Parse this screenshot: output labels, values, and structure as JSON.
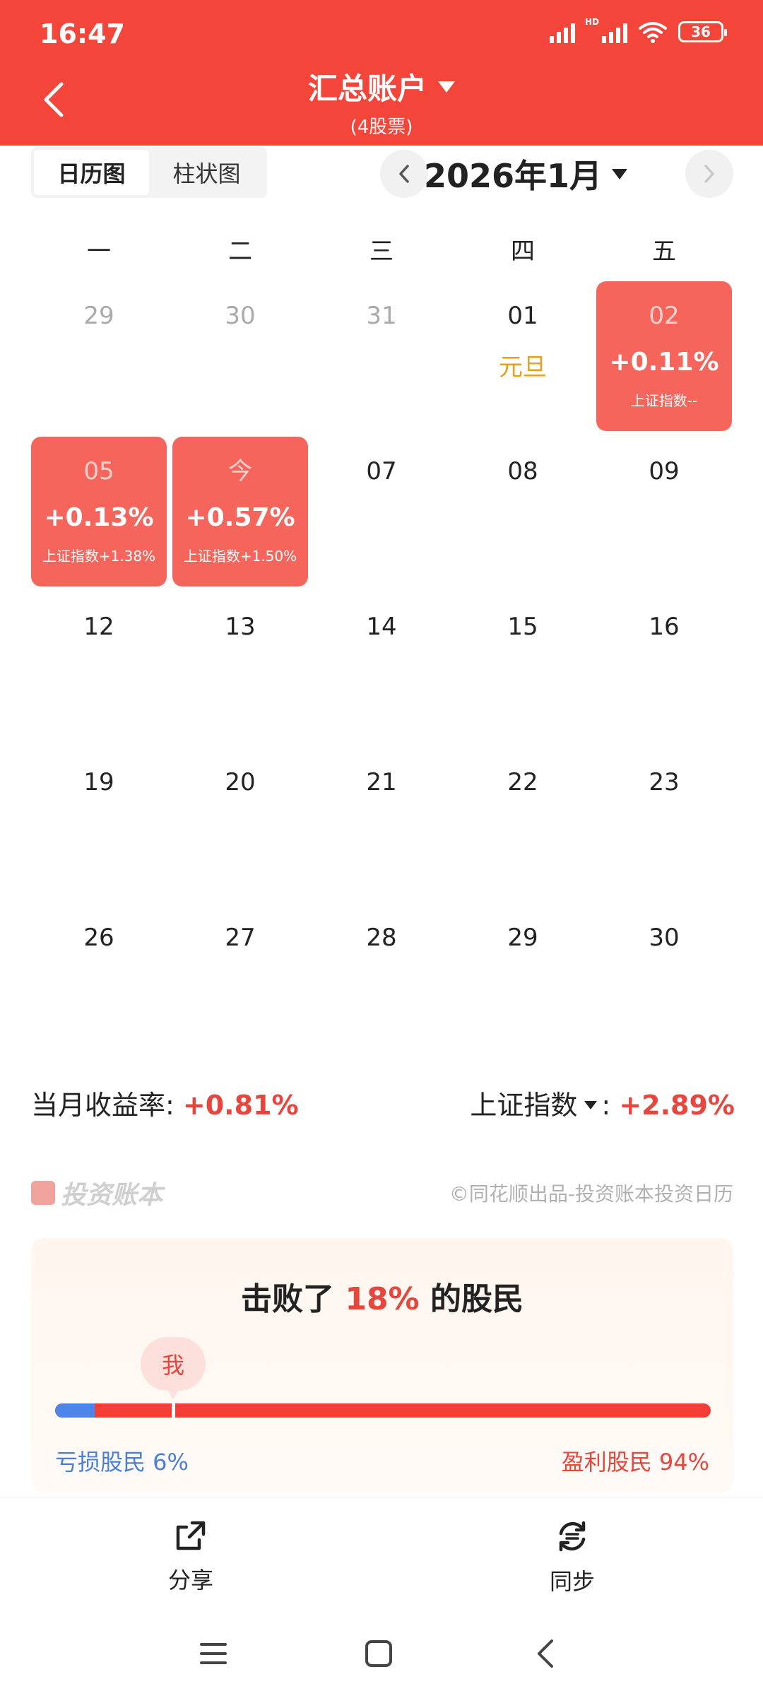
{
  "status_bar": {
    "time": "16:47",
    "hd": "HD",
    "battery": "36"
  },
  "header": {
    "title": "汇总账户",
    "subtitle": "(4股票)"
  },
  "view_toggle": {
    "options": [
      "日历图",
      "柱状图"
    ],
    "active": 0
  },
  "month_nav": {
    "label": "2026年1月"
  },
  "weekdays": [
    "一",
    "二",
    "三",
    "四",
    "五"
  ],
  "calendar": {
    "week1": [
      {
        "day": "29",
        "dim": true
      },
      {
        "day": "30",
        "dim": true
      },
      {
        "day": "31",
        "dim": true
      },
      {
        "day": "01",
        "holiday": "元旦"
      },
      {
        "day": "02",
        "profit": "+0.11%",
        "index": "上证指数--"
      }
    ],
    "week2": [
      {
        "day": "05",
        "profit": "+0.13%",
        "index": "上证指数+1.38%"
      },
      {
        "day": "今",
        "profit": "+0.57%",
        "index": "上证指数+1.50%"
      },
      {
        "day": "07"
      },
      {
        "day": "08"
      },
      {
        "day": "09"
      }
    ],
    "week3": [
      {
        "day": "12"
      },
      {
        "day": "13"
      },
      {
        "day": "14"
      },
      {
        "day": "15"
      },
      {
        "day": "16"
      }
    ],
    "week4": [
      {
        "day": "19"
      },
      {
        "day": "20"
      },
      {
        "day": "21"
      },
      {
        "day": "22"
      },
      {
        "day": "23"
      }
    ],
    "week5": [
      {
        "day": "26"
      },
      {
        "day": "27"
      },
      {
        "day": "28"
      },
      {
        "day": "29"
      },
      {
        "day": "30"
      }
    ]
  },
  "summary": {
    "monthly_label": "当月收益率:",
    "monthly_value": "+0.81%",
    "index_label": "上证指数",
    "index_colon": ":",
    "index_value": "+2.89%"
  },
  "brand": {
    "name": "投资账本",
    "copyright": "©同花顺出品-投资账本投资日历"
  },
  "beat": {
    "prefix": "击败了",
    "percent": "18%",
    "suffix": "的股民",
    "me_label": "我",
    "loss_label": "亏损股民 6%",
    "win_label": "盈利股民 94%",
    "loss_fraction": 0.06,
    "me_fraction": 0.18
  },
  "actions": {
    "share": "分享",
    "sync": "同步"
  },
  "colors": {
    "header": "#f4453a",
    "profit_cell": "#f5655c",
    "loss_bar": "#4d86e8",
    "win_bar": "#f23e36",
    "holiday": "#e6a01d"
  }
}
